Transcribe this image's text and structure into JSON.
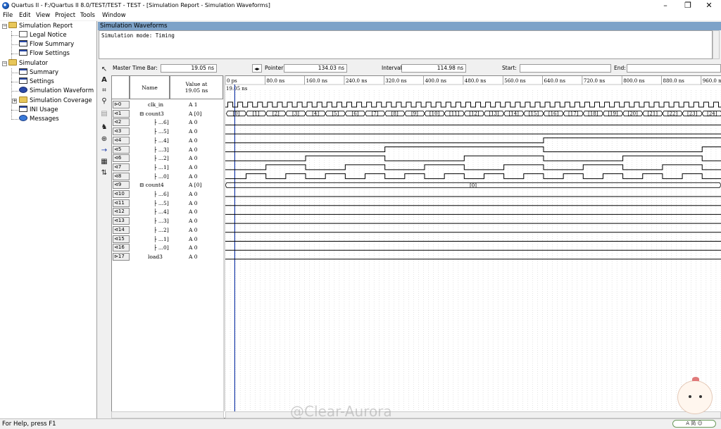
{
  "window": {
    "title": "Quartus II - F:/Quartus II 8.0/TEST/TEST - TEST - [Simulation Report - Simulation Waveforms]",
    "min_label": "–",
    "max_label": "❐",
    "close_label": "✕"
  },
  "menu": [
    "File",
    "Edit",
    "View",
    "Project",
    "Tools",
    "Window"
  ],
  "tree": {
    "root": "Simulation Report",
    "items": [
      {
        "label": "Legal Notice",
        "icon": "doc"
      },
      {
        "label": "Flow Summary",
        "icon": "table"
      },
      {
        "label": "Flow Settings",
        "icon": "table"
      }
    ],
    "simulator": {
      "label": "Simulator",
      "items": [
        {
          "label": "Summary",
          "icon": "table"
        },
        {
          "label": "Settings",
          "icon": "table"
        },
        {
          "label": "Simulation Waveform",
          "icon": "wave"
        },
        {
          "label": "Simulation Coverage",
          "icon": "folder"
        },
        {
          "label": "INI Usage",
          "icon": "table"
        },
        {
          "label": "Messages",
          "icon": "msg"
        }
      ]
    }
  },
  "section_header": "Simulation Waveforms",
  "sim_mode": "Simulation mode: Timing",
  "timebar": {
    "master_label": "Master Time Bar:",
    "master_value": "19.05 ns",
    "pointer_label": "Pointer:",
    "pointer_value": "134.03 ns",
    "interval_label": "Interval:",
    "interval_value": "114.98 ns",
    "start_label": "Start:",
    "start_value": "",
    "end_label": "End:",
    "end_value": ""
  },
  "columns": {
    "name": "Name",
    "value": "Value at\n19.05 ns"
  },
  "time_ruler": {
    "ticks": [
      "0 ps",
      "80.0 ns",
      "160.0 ns",
      "240.0 ns",
      "320.0 ns",
      "400.0 ns",
      "480.0 ns",
      "560.0 ns",
      "640.0 ns",
      "720.0 ns",
      "800.0 ns",
      "880.0 ns",
      "960.0 ns"
    ],
    "marker_label": "19.05 ns"
  },
  "signals": [
    {
      "id": "0",
      "name": "clk_in",
      "value": "A 1",
      "type": "input"
    },
    {
      "id": "1",
      "name": "count3",
      "value": "A [0]",
      "type": "bus",
      "group": true
    },
    {
      "id": "2",
      "name": "...6]",
      "value": "A 0",
      "type": "out"
    },
    {
      "id": "3",
      "name": "...5]",
      "value": "A 0",
      "type": "out"
    },
    {
      "id": "4",
      "name": "...4]",
      "value": "A 0",
      "type": "out"
    },
    {
      "id": "5",
      "name": "...3]",
      "value": "A 0",
      "type": "out"
    },
    {
      "id": "6",
      "name": "...2]",
      "value": "A 0",
      "type": "out"
    },
    {
      "id": "7",
      "name": "...1]",
      "value": "A 0",
      "type": "out"
    },
    {
      "id": "8",
      "name": "...0]",
      "value": "A 0",
      "type": "out"
    },
    {
      "id": "9",
      "name": "count4",
      "value": "A [0]",
      "type": "bus",
      "group": true
    },
    {
      "id": "10",
      "name": "...6]",
      "value": "A 0",
      "type": "out"
    },
    {
      "id": "11",
      "name": "...5]",
      "value": "A 0",
      "type": "out"
    },
    {
      "id": "12",
      "name": "...4]",
      "value": "A 0",
      "type": "out"
    },
    {
      "id": "13",
      "name": "...3]",
      "value": "A 0",
      "type": "out"
    },
    {
      "id": "14",
      "name": "...2]",
      "value": "A 0",
      "type": "out"
    },
    {
      "id": "15",
      "name": "...1]",
      "value": "A 0",
      "type": "out"
    },
    {
      "id": "16",
      "name": "...0]",
      "value": "A 0",
      "type": "out"
    },
    {
      "id": "17",
      "name": "load3",
      "value": "A 0",
      "type": "input"
    }
  ],
  "count3_bus_labels": [
    "[0]",
    "[1]",
    "[2]",
    "[3]",
    "[4]",
    "[5]",
    "[6]",
    "[7]",
    "[8]",
    "[9]",
    "[10]",
    "[11]",
    "[12]",
    "[13]",
    "[14]",
    "[15]",
    "[16]",
    "[17]",
    "[18]",
    "[19]",
    "[20]",
    "[21]",
    "[22]",
    "[23]",
    "[24]"
  ],
  "count4_bus_label": "[0]",
  "status": "For Help, press F1",
  "ime": "A  简  ☺",
  "watermark": "@Clear-Aurora",
  "colors": {
    "header_bg": "#7da2c8",
    "wave": "#000000",
    "marker": "#1a3aa8",
    "grid": "#c8c8c8"
  }
}
